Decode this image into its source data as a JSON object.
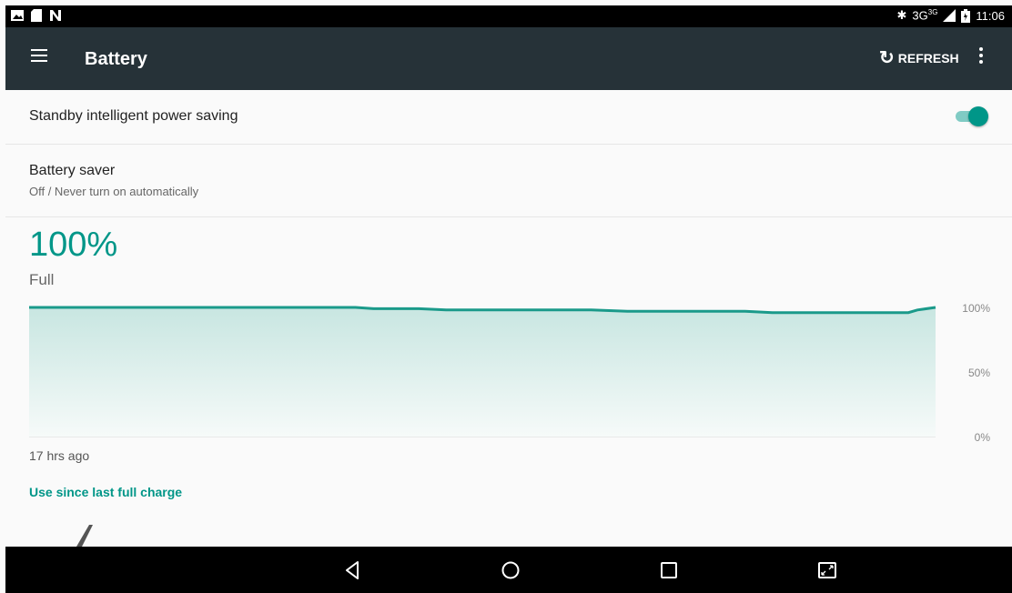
{
  "status_bar": {
    "left_icons": [
      "image-icon",
      "sd-card-icon",
      "nfc-icon"
    ],
    "network": "3G",
    "network_superscript": "3G",
    "time": "11:06"
  },
  "toolbar": {
    "title": "Battery",
    "refresh_label": "REFRESH"
  },
  "settings": {
    "standby": {
      "label": "Standby intelligent power saving",
      "enabled": true
    },
    "battery_saver": {
      "label": "Battery saver",
      "summary": "Off / Never turn on automatically"
    }
  },
  "battery": {
    "percent": "100%",
    "status": "Full",
    "graph_start_label": "17 hrs ago",
    "use_since_label": "Use since last full charge"
  },
  "colors": {
    "accent": "#009688",
    "toolbar": "#263238",
    "chart_line": "#1a9a8a"
  },
  "chart_data": {
    "type": "area",
    "y_ticks": [
      "100%",
      "50%",
      "0%"
    ],
    "ylim": [
      0,
      100
    ],
    "x_start_label": "17 hrs ago",
    "x": [
      0,
      0.36,
      0.38,
      0.43,
      0.46,
      0.62,
      0.66,
      0.79,
      0.82,
      0.97,
      0.98,
      1.0
    ],
    "values": [
      100,
      100,
      99,
      99,
      98,
      98,
      97,
      97,
      96,
      96,
      98,
      100
    ]
  }
}
